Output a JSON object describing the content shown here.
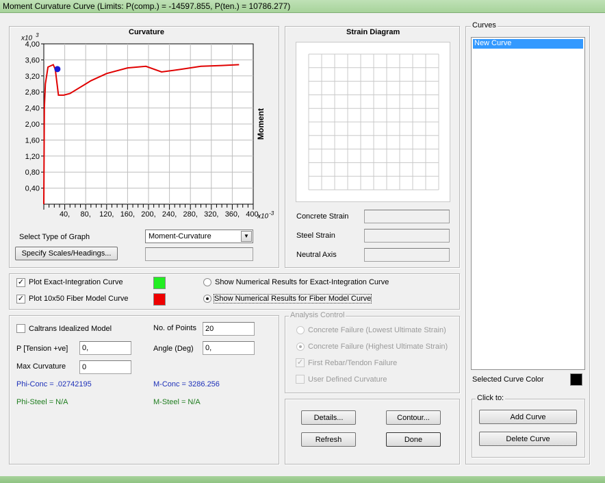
{
  "window": {
    "title": "Moment Curvature Curve (Limits:  P(comp.) = -14597.855, P(ten.) = 10786.277)"
  },
  "curvature_panel": {
    "title": "Curvature",
    "moment_label": "Moment",
    "x_exp": "x10",
    "x_exp_sup": "-3",
    "y_exp": "x10",
    "y_exp_sup": "3",
    "select_type_label": "Select Type of Graph",
    "graph_type_value": "Moment-Curvature",
    "specify_scales_label": "Specify Scales/Headings..."
  },
  "chart_data": {
    "type": "line",
    "xlim": [
      0,
      400
    ],
    "ylim": [
      0,
      4.0
    ],
    "x_ticks": [
      "40,",
      "80,",
      "120,",
      "160,",
      "200,",
      "240,",
      "280,",
      "320,",
      "360,",
      "400,"
    ],
    "y_ticks": [
      "4,00",
      "3,60",
      "3,20",
      "2,80",
      "2,40",
      "2,00",
      "1,60",
      "1,20",
      "0,80",
      "0,40"
    ],
    "series": [
      {
        "color": "#e00000",
        "x": [
          0,
          1,
          3,
          8,
          18,
          22,
          28,
          38,
          50,
          70,
          90,
          120,
          160,
          195,
          225,
          260,
          300,
          340,
          373
        ],
        "y": [
          0,
          2.4,
          3.0,
          3.42,
          3.48,
          3.36,
          2.72,
          2.72,
          2.76,
          2.92,
          3.08,
          3.26,
          3.4,
          3.44,
          3.3,
          3.36,
          3.44,
          3.46,
          3.48
        ]
      }
    ],
    "marker": {
      "x": 26,
      "y": 3.37,
      "color": "#1a1ad6"
    }
  },
  "strain_panel": {
    "title": "Strain Diagram",
    "concrete_strain_label": "Concrete Strain",
    "steel_strain_label": "Steel Strain",
    "neutral_axis_label": "Neutral Axis"
  },
  "curves_panel": {
    "legend": "Curves",
    "items": [
      "New Curve"
    ],
    "selected_color_label": "Selected Curve Color",
    "selected_color": "#000000",
    "click_to_legend": "Click to:",
    "add_curve_label": "Add Curve",
    "delete_curve_label": "Delete Curve"
  },
  "plot_options": {
    "exact_label": "Plot Exact-Integration Curve",
    "exact_checked": true,
    "exact_color": "#22ee22",
    "fiber_label": "Plot 10x50 Fiber Model Curve",
    "fiber_checked": true,
    "fiber_color": "#ee0000",
    "show_exact_label": "Show Numerical Results for Exact-Integration Curve",
    "show_fiber_label": "Show Numerical Results for Fiber Model Curve"
  },
  "params": {
    "caltrans_label": "Caltrans Idealized Model",
    "num_points_label": "No. of Points",
    "num_points_value": "20",
    "p_label": "P [Tension +ve]",
    "p_value": "0,",
    "angle_label": "Angle (Deg)",
    "angle_value": "0,",
    "max_curv_label": "Max Curvature",
    "max_curv_value": "0",
    "phi_conc": "Phi-Conc = .02742195",
    "m_conc": "M-Conc = 3286.256",
    "phi_steel": "Phi-Steel = N/A",
    "m_steel": "M-Steel = N/A"
  },
  "analysis_control": {
    "legend": "Analysis Control",
    "opt1": "Concrete Failure (Lowest Ultimate Strain)",
    "opt2": "Concrete Failure (Highest Ultimate Strain)",
    "opt3": "First Rebar/Tendon Failure",
    "opt4": "User Defined Curvature"
  },
  "actions": {
    "details_label": "Details...",
    "contour_label": "Contour...",
    "refresh_label": "Refresh",
    "done_label": "Done"
  }
}
